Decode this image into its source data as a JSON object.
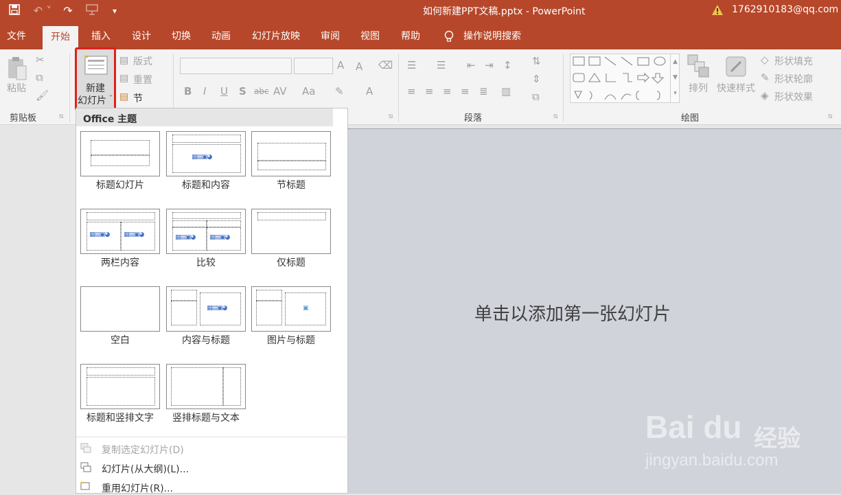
{
  "titlebar": {
    "doc_title": "如何新建PPT文稿.pptx  -  PowerPoint",
    "account": "1762910183@qq.com"
  },
  "tabs": [
    {
      "label": "文件"
    },
    {
      "label": "开始"
    },
    {
      "label": "插入"
    },
    {
      "label": "设计"
    },
    {
      "label": "切换"
    },
    {
      "label": "动画"
    },
    {
      "label": "幻灯片放映"
    },
    {
      "label": "审阅"
    },
    {
      "label": "视图"
    },
    {
      "label": "帮助"
    }
  ],
  "tell_me": "操作说明搜索",
  "ribbon": {
    "clipboard": {
      "paste_label": "粘贴",
      "group_label": "剪贴板"
    },
    "slides": {
      "new_slide_line1": "新建",
      "new_slide_line2": "幻灯片",
      "layout_label": "版式",
      "reset_label": "重置",
      "section_label": "节"
    },
    "paragraph": {
      "group_label": "段落"
    },
    "drawing": {
      "arrange_label": "排列",
      "quick_styles_label": "快速样式",
      "shape_fill": "形状填充",
      "shape_outline": "形状轮廓",
      "shape_effects": "形状效果",
      "group_label": "绘图"
    }
  },
  "gallery": {
    "title": "Office 主题",
    "layouts": [
      {
        "name": "标题幻灯片"
      },
      {
        "name": "标题和内容"
      },
      {
        "name": "节标题"
      },
      {
        "name": "两栏内容"
      },
      {
        "name": "比较"
      },
      {
        "name": "仅标题"
      },
      {
        "name": "空白"
      },
      {
        "name": "内容与标题"
      },
      {
        "name": "图片与标题"
      },
      {
        "name": "标题和竖排文字"
      },
      {
        "name": "竖排标题与文本"
      }
    ],
    "menu": [
      {
        "label": "复制选定幻灯片(D)",
        "enabled": false
      },
      {
        "label": "幻灯片(从大纲)(L)...",
        "enabled": true
      },
      {
        "label": "重用幻灯片(R)...",
        "enabled": true
      }
    ]
  },
  "slide": {
    "placeholder": "单击以添加第一张幻灯片"
  },
  "watermark": {
    "logo": "Bai du",
    "brand": "经验",
    "url": "jingyan.baidu.com"
  },
  "colors": {
    "accent": "#b7472a",
    "highlight": "#e0201a",
    "slide_bg": "#d0d3da"
  }
}
